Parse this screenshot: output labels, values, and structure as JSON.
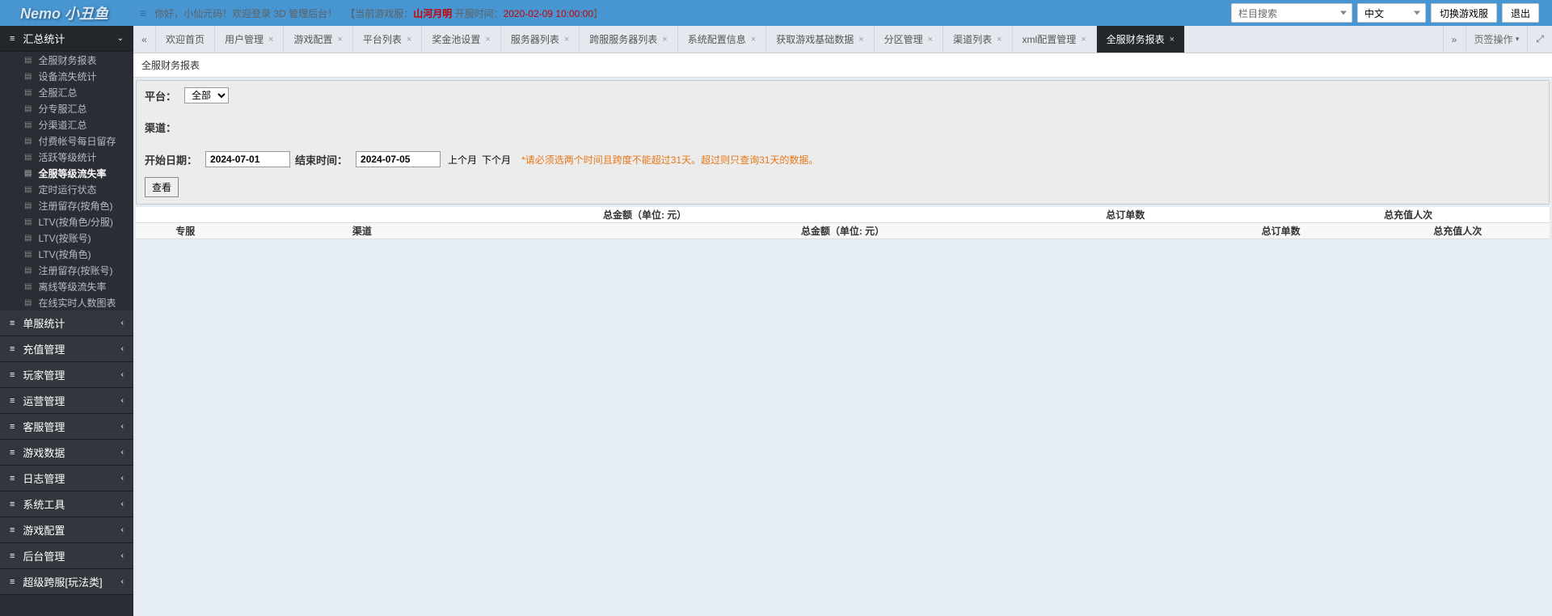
{
  "logo": "Nemo 小丑鱼",
  "greeting": {
    "prefix": "你好，小仙元码！欢迎登录 3D 管理后台！",
    "server_label": "【当前游戏服：",
    "server_name": "山河月明",
    "open_label": " 开服时间：",
    "open_time": "2020-02-09 10:00:00",
    "suffix": "】"
  },
  "header": {
    "column_search": "栏目搜索",
    "lang": "中文",
    "switch_server": "切换游戏服",
    "logout": "退出"
  },
  "sidebar": {
    "group_active": "汇总统计",
    "subs": [
      "全服财务报表",
      "设备流失统计",
      "全服汇总",
      "分专服汇总",
      "分渠道汇总",
      "付费帐号每日留存",
      "活跃等级统计",
      "全服等级流失率",
      "定时运行状态",
      "注册留存(按角色)",
      "LTV(按角色/分服)",
      "LTV(按账号)",
      "LTV(按角色)",
      "注册留存(按账号)",
      "离线等级流失率",
      "在线实时人数图表"
    ],
    "groups_collapsed": [
      "单服统计",
      "充值管理",
      "玩家管理",
      "运营管理",
      "客服管理",
      "游戏数据",
      "日志管理",
      "系统工具",
      "游戏配置",
      "后台管理",
      "超级跨服[玩法类]"
    ]
  },
  "tabs": {
    "items": [
      "欢迎首页",
      "用户管理",
      "游戏配置",
      "平台列表",
      "奖金池设置",
      "服务器列表",
      "跨服服务器列表",
      "系统配置信息",
      "获取游戏基础数据",
      "分区管理",
      "渠道列表",
      "xml配置管理",
      "全服财务报表"
    ],
    "page_ops": "页签操作"
  },
  "page": {
    "title": "全服财务报表"
  },
  "filter": {
    "platform_label": "平台：",
    "platform_value": "全部",
    "channel_label": "渠道：",
    "start_label": "开始日期：",
    "start_value": "2024-07-01",
    "end_label": "结束时间：",
    "end_value": "2024-07-05",
    "prev_month": "上个月",
    "next_month": "下个月",
    "hint": "*请必须选两个时间且跨度不能超过31天。超过则只查询31天的数据。",
    "query": "查看"
  },
  "table": {
    "h1": [
      "总金额（单位: 元）",
      "总订单数",
      "总充值人次"
    ],
    "h2": [
      "专服",
      "渠道",
      "总金额（单位: 元）",
      "总订单数",
      "总充值人次"
    ]
  }
}
